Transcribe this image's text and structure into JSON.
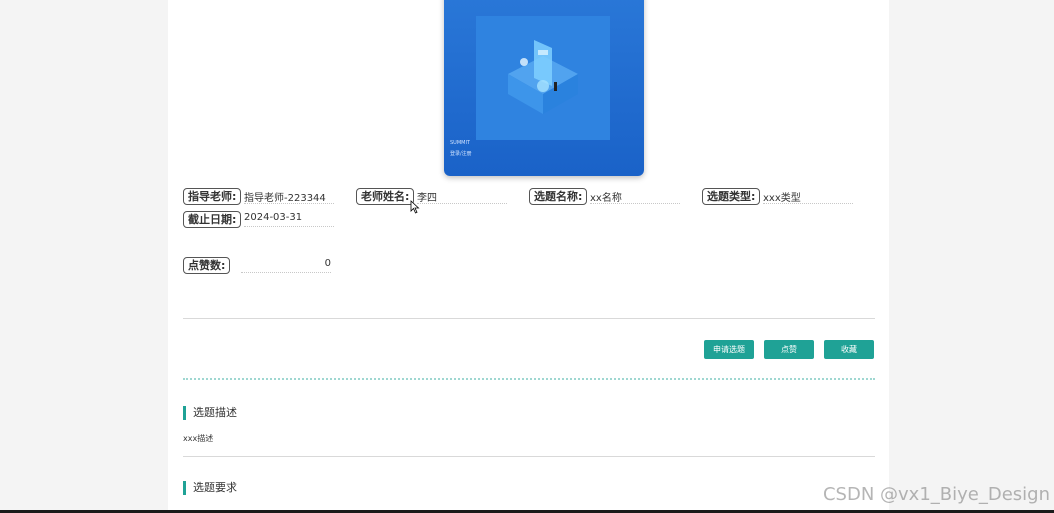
{
  "cover": {
    "tiny_title": "SUMMIT",
    "tiny_sub": "登录/注册"
  },
  "fields": {
    "teacher_label": "指导老师:",
    "teacher_value": "指导老师-223344",
    "teacher_name_label": "老师姓名:",
    "teacher_name_value": "李四",
    "topic_name_label": "选题名称:",
    "topic_name_value": "xx名称",
    "topic_type_label": "选题类型:",
    "topic_type_value": "xxx类型",
    "deadline_label": "截止日期:",
    "deadline_value": "2024-03-31",
    "likes_label": "点赞数:",
    "likes_value": "0"
  },
  "actions": {
    "apply_label": "申请选题",
    "like_label": "点赞",
    "favorite_label": "收藏"
  },
  "sections": {
    "description_title": "选题描述",
    "description_text": "xxx描述",
    "requirements_title": "选题要求"
  },
  "watermark": "CSDN @vx1_Biye_Design",
  "colors": {
    "accent": "#1fa296",
    "cover_blue": "#1a62c8"
  }
}
